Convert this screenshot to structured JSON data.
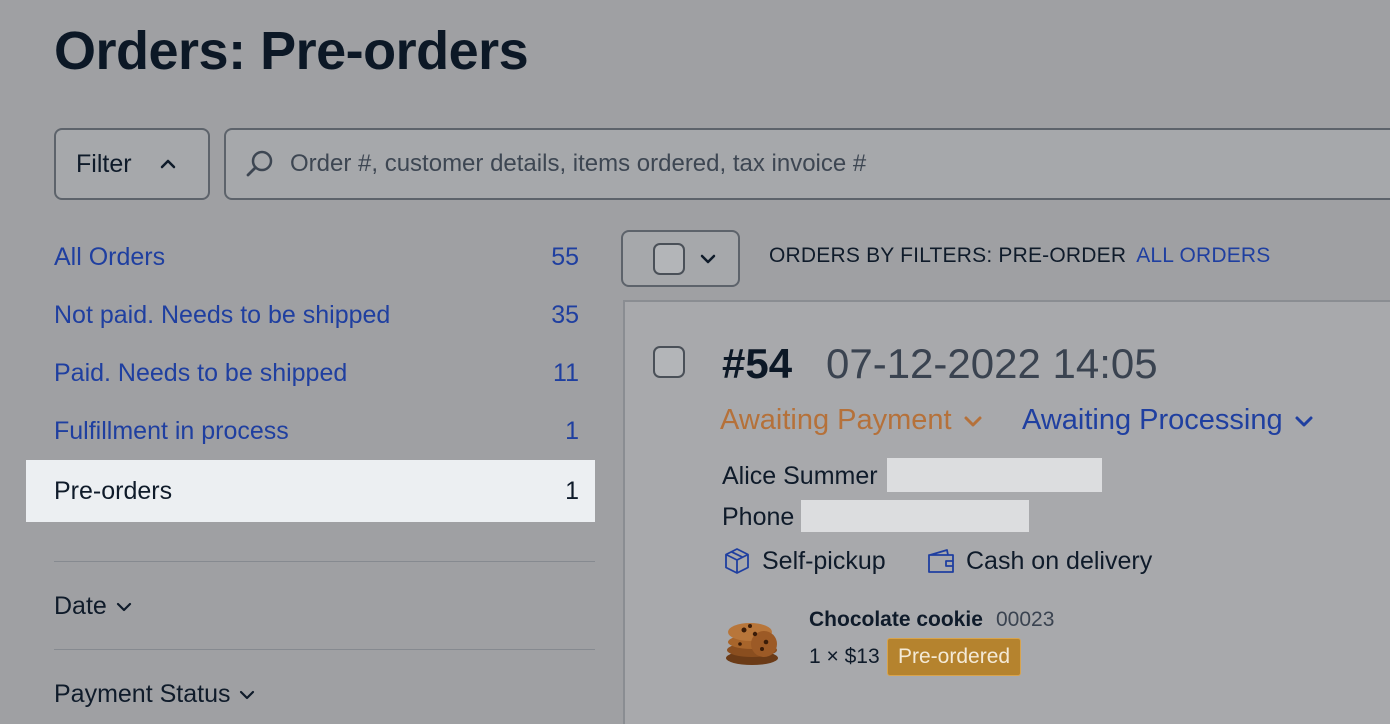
{
  "page": {
    "title": "Orders: Pre-orders"
  },
  "filter": {
    "label": "Filter"
  },
  "search": {
    "placeholder": "Order #, customer details, items ordered, tax invoice #"
  },
  "sidebar": {
    "items": [
      {
        "label": "All Orders",
        "count": "55"
      },
      {
        "label": "Not paid. Needs to be shipped",
        "count": "35"
      },
      {
        "label": "Paid. Needs to be shipped",
        "count": "11"
      },
      {
        "label": "Fulfillment in process",
        "count": "1"
      },
      {
        "label": "Pre-orders",
        "count": "1"
      }
    ],
    "sections": [
      {
        "label": "Date"
      },
      {
        "label": "Payment Status"
      }
    ]
  },
  "toolbar": {
    "filters_text": "ORDERS BY FILTERS: PRE-ORDER",
    "all_orders_link": "ALL ORDERS"
  },
  "order": {
    "number": "#54",
    "date": "07-12-2022 14:05",
    "payment_status": "Awaiting Payment",
    "fulfillment_status": "Awaiting Processing",
    "customer_name": "Alice Summer",
    "phone_label": "Phone",
    "shipping_method": "Self-pickup",
    "payment_method": "Cash on delivery",
    "item": {
      "name": "Chocolate cookie",
      "sku": "00023",
      "qty_price": "1 × $13",
      "badge": "Pre-ordered"
    }
  },
  "colors": {
    "accent_link": "#1f3fa0",
    "payment_status": "#b5713a",
    "badge_bg": "#b5832e"
  }
}
